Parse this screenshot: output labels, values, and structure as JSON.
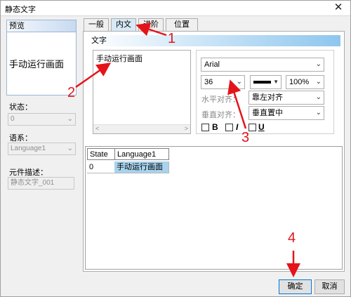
{
  "window": {
    "title": "静态文字",
    "close_glyph": "✕"
  },
  "left": {
    "preview_label": "预览",
    "preview_text": "手动运行画面",
    "state_label": "状态：",
    "state_value": "0",
    "language_label": "语系：",
    "language_value": "Language1",
    "desc_label": "元件描述：",
    "desc_value": "静态文字_001"
  },
  "tabs": [
    {
      "label": "一般"
    },
    {
      "label": "内文"
    },
    {
      "label": "进阶"
    },
    {
      "label": "位置"
    }
  ],
  "content": {
    "group_title": "文字",
    "text_value": "手动运行画面",
    "font": "Arial",
    "size": "36",
    "color": "#000000",
    "zoom": "100%",
    "h_align_label": "水平对齐：",
    "h_align_value": "靠左对齐",
    "v_align_label": "垂直对齐：",
    "v_align_value": "垂直置中",
    "bold_label": "B",
    "italic_label": "I",
    "underline_label": "U"
  },
  "table": {
    "headers": [
      "State",
      "Language1"
    ],
    "rows": [
      {
        "state": "0",
        "text": "手动运行画面"
      }
    ]
  },
  "buttons": {
    "ok": "确定",
    "cancel": "取消"
  },
  "annotations": {
    "n1": "1",
    "n2": "2",
    "n3": "3",
    "n4": "4",
    "color": "#e4141a"
  }
}
